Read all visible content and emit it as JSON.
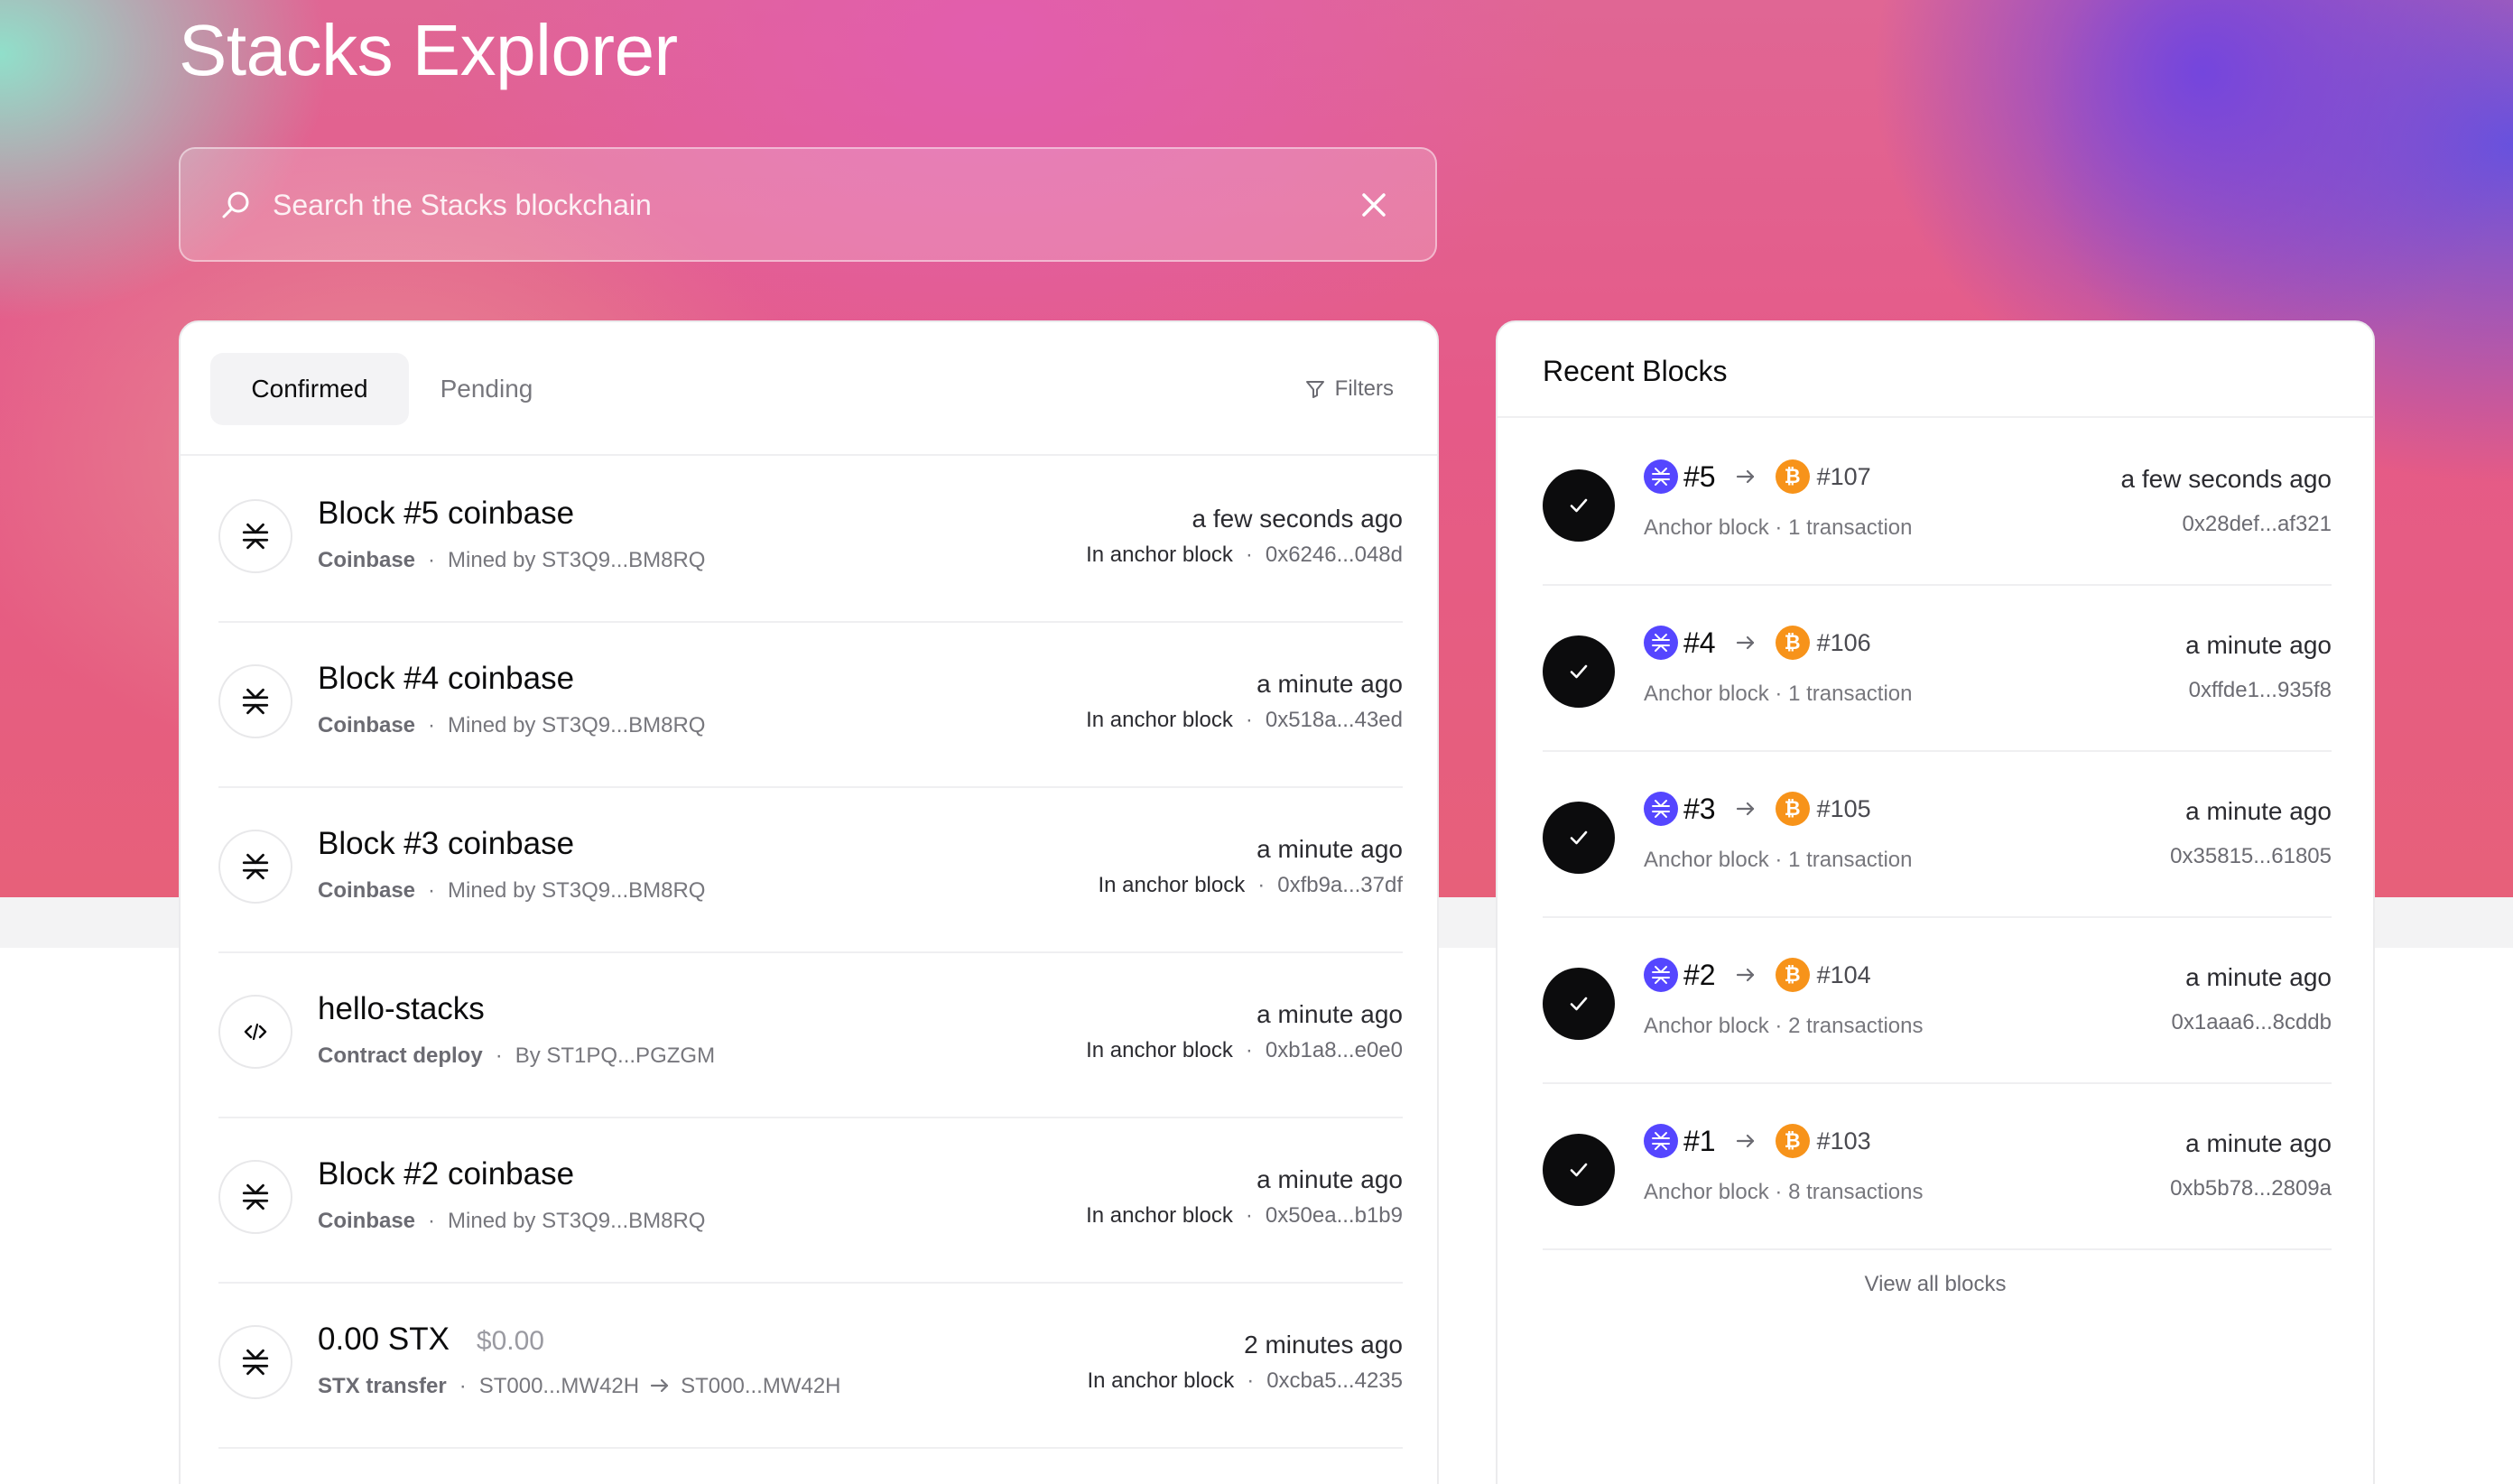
{
  "header": {
    "title": "Stacks Explorer"
  },
  "search": {
    "placeholder": "Search the Stacks blockchain",
    "value": ""
  },
  "tabs": {
    "confirmed": "Confirmed",
    "pending": "Pending",
    "filters": "Filters"
  },
  "transactions": [
    {
      "title": "Block #5 coinbase",
      "kind": "Coinbase",
      "detail": "Mined by ST3Q9...BM8RQ",
      "time": "a few seconds ago",
      "block_label": "In anchor block",
      "hash": "0x6246...048d",
      "icon": "stacks-icon"
    },
    {
      "title": "Block #4 coinbase",
      "kind": "Coinbase",
      "detail": "Mined by ST3Q9...BM8RQ",
      "time": "a minute ago",
      "block_label": "In anchor block",
      "hash": "0x518a...43ed",
      "icon": "stacks-icon"
    },
    {
      "title": "Block #3 coinbase",
      "kind": "Coinbase",
      "detail": "Mined by ST3Q9...BM8RQ",
      "time": "a minute ago",
      "block_label": "In anchor block",
      "hash": "0xfb9a...37df",
      "icon": "stacks-icon"
    },
    {
      "title": "hello-stacks",
      "kind": "Contract deploy",
      "detail": "By ST1PQ...PGZGM",
      "time": "a minute ago",
      "block_label": "In anchor block",
      "hash": "0xb1a8...e0e0",
      "icon": "code-icon"
    },
    {
      "title": "Block #2 coinbase",
      "kind": "Coinbase",
      "detail": "Mined by ST3Q9...BM8RQ",
      "time": "a minute ago",
      "block_label": "In anchor block",
      "hash": "0x50ea...b1b9",
      "icon": "stacks-icon"
    },
    {
      "title": "0.00 STX",
      "usd": "$0.00",
      "kind": "STX transfer",
      "from": "ST000...MW42H",
      "to": "ST000...MW42H",
      "time": "2 minutes ago",
      "block_label": "In anchor block",
      "hash": "0xcba5...4235",
      "icon": "stacks-icon"
    }
  ],
  "recent_blocks": {
    "title": "Recent Blocks",
    "view_all": "View all blocks",
    "items": [
      {
        "stx": "#5",
        "btc": "#107",
        "sub": "Anchor block · 1 transaction",
        "time": "a few seconds ago",
        "hash": "0x28def...af321"
      },
      {
        "stx": "#4",
        "btc": "#106",
        "sub": "Anchor block · 1 transaction",
        "time": "a minute ago",
        "hash": "0xffde1...935f8"
      },
      {
        "stx": "#3",
        "btc": "#105",
        "sub": "Anchor block · 1 transaction",
        "time": "a minute ago",
        "hash": "0x35815...61805"
      },
      {
        "stx": "#2",
        "btc": "#104",
        "sub": "Anchor block · 2 transactions",
        "time": "a minute ago",
        "hash": "0x1aaa6...8cddb"
      },
      {
        "stx": "#1",
        "btc": "#103",
        "sub": "Anchor block · 8 transactions",
        "time": "a minute ago",
        "hash": "0xb5b78...2809a"
      }
    ]
  },
  "colors": {
    "stacks_purple": "#5546ff",
    "bitcoin_orange": "#f7931a",
    "text_primary": "#0c0c0d",
    "text_muted": "#77777d"
  }
}
